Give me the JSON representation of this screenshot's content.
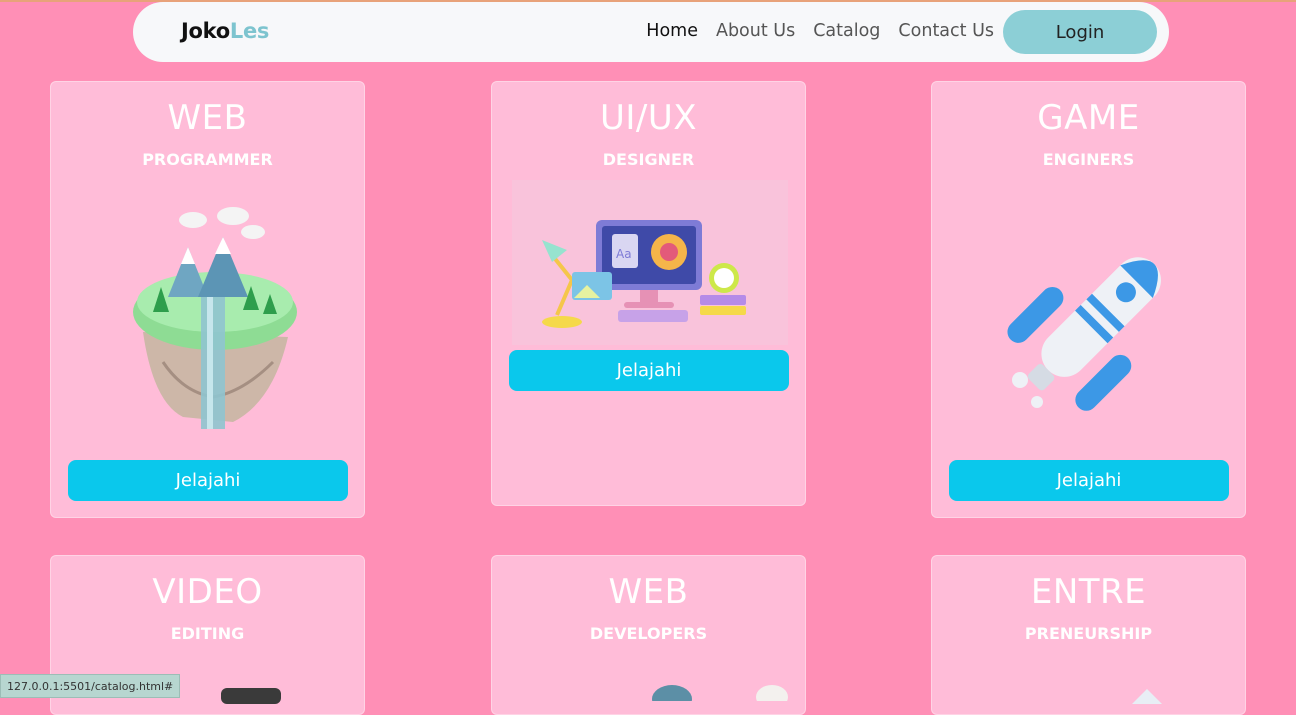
{
  "brand": {
    "part1": "Joko",
    "part2": "Les"
  },
  "nav": {
    "home": "Home",
    "about": "About Us",
    "catalog": "Catalog",
    "contact": "Contact Us",
    "login": "Login"
  },
  "cards": [
    {
      "title": "WEB",
      "subtitle": "PROGRAMMER",
      "button": "Jelajahi"
    },
    {
      "title": "UI/UX",
      "subtitle": "DESIGNER",
      "button": "Jelajahi"
    },
    {
      "title": "GAME",
      "subtitle": "ENGINERS",
      "button": "Jelajahi"
    },
    {
      "title": "VIDEO",
      "subtitle": "EDITING"
    },
    {
      "title": "WEB",
      "subtitle": "DEVELOPERS"
    },
    {
      "title": "ENTRE",
      "subtitle": "PRENEURSHIP"
    }
  ],
  "status_url": "127.0.0.1:5501/catalog.html#",
  "colors": {
    "background": "#ff8fb6",
    "card": "#ffbcd8",
    "button": "#0ac8ec",
    "login": "#8ccfd6"
  }
}
